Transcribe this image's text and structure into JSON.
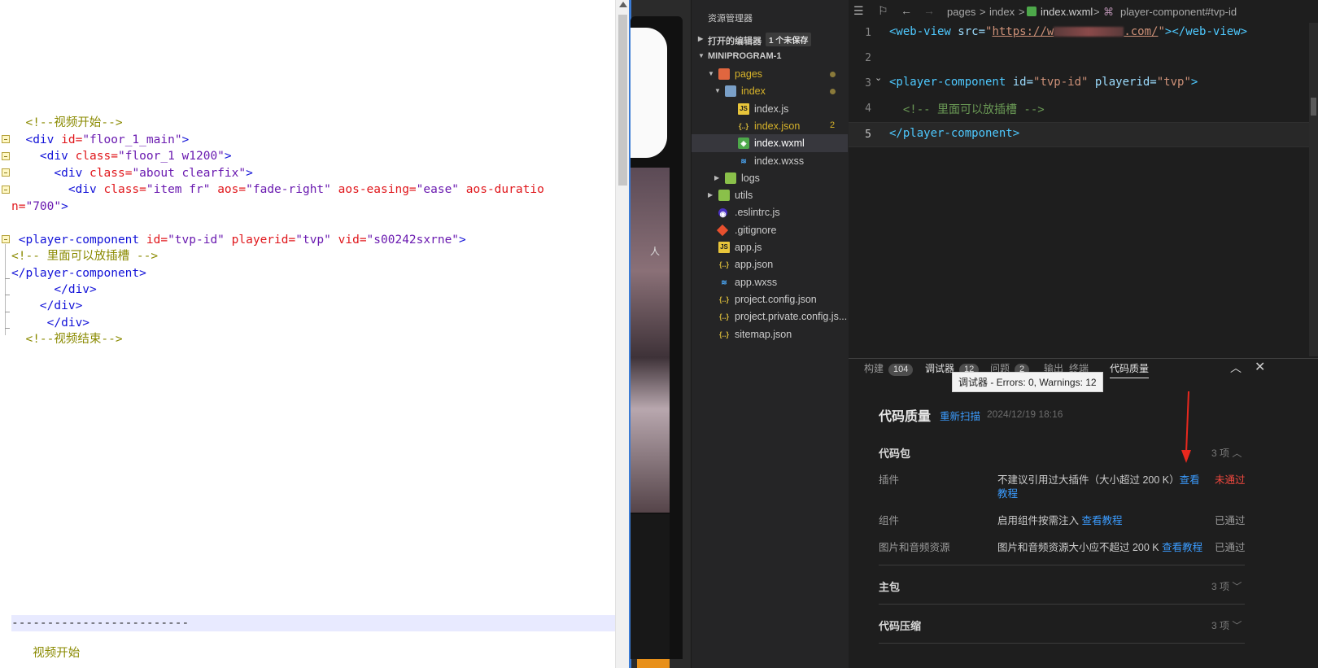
{
  "left_editor": {
    "lines": [
      {
        "indent": "  ",
        "parts": [
          [
            "c-com",
            "<!--视频开始-->"
          ]
        ]
      },
      {
        "indent": "  ",
        "parts": [
          [
            "c-tag",
            "<div "
          ],
          [
            "c-attr",
            "id="
          ],
          [
            "c-val",
            "\"floor_1_main\""
          ],
          [
            "c-tag",
            ">"
          ]
        ]
      },
      {
        "indent": "    ",
        "parts": [
          [
            "c-tag",
            "<div "
          ],
          [
            "c-attr",
            "class="
          ],
          [
            "c-val",
            "\"floor_1 w1200\""
          ],
          [
            "c-tag",
            ">"
          ]
        ]
      },
      {
        "indent": "      ",
        "parts": [
          [
            "c-tag",
            "<div "
          ],
          [
            "c-attr",
            "class="
          ],
          [
            "c-val",
            "\"about clearfix\""
          ],
          [
            "c-tag",
            ">"
          ]
        ]
      },
      {
        "indent": "        ",
        "parts": [
          [
            "c-tag",
            "<div "
          ],
          [
            "c-attr",
            "class="
          ],
          [
            "c-val",
            "\"item fr\" "
          ],
          [
            "c-attr",
            "aos="
          ],
          [
            "c-val",
            "\"fade-right\" "
          ],
          [
            "c-attr",
            "aos-easing="
          ],
          [
            "c-val",
            "\"ease\" "
          ],
          [
            "c-attr",
            "aos-duratio"
          ]
        ]
      },
      {
        "indent": "",
        "parts": [
          [
            "c-attr",
            "n="
          ],
          [
            "c-val",
            "\"700\""
          ],
          [
            "c-tag",
            ">"
          ]
        ]
      },
      {
        "indent": "",
        "parts": []
      },
      {
        "indent": " ",
        "parts": [
          [
            "c-tag",
            "<player-component "
          ],
          [
            "c-attr",
            "id="
          ],
          [
            "c-val",
            "\"tvp-id\" "
          ],
          [
            "c-attr",
            "playerid="
          ],
          [
            "c-val",
            "\"tvp\" "
          ],
          [
            "c-attr",
            "vid="
          ],
          [
            "c-val",
            "\"s00242sxrne\""
          ],
          [
            "c-tag",
            ">"
          ]
        ]
      },
      {
        "indent": "",
        "parts": [
          [
            "c-com",
            "<!-- 里面可以放插槽 -->"
          ]
        ]
      },
      {
        "indent": "",
        "parts": [
          [
            "c-tag",
            "</player-component>"
          ]
        ]
      },
      {
        "indent": "      ",
        "parts": [
          [
            "c-tag",
            "</div>"
          ]
        ]
      },
      {
        "indent": "    ",
        "parts": [
          [
            "c-tag",
            "</div>"
          ]
        ]
      },
      {
        "indent": "     ",
        "parts": [
          [
            "c-tag",
            "</div>"
          ]
        ]
      },
      {
        "indent": "  ",
        "parts": [
          [
            "c-com",
            "<!--视频结束-->"
          ]
        ]
      }
    ],
    "divider_text": "-------------------------",
    "bottom_partial": "   视频开始"
  },
  "simulator": {
    "label": "人"
  },
  "explorer": {
    "title": "资源管理器",
    "more": "···",
    "open_editors": {
      "label": "打开的编辑器",
      "badge": "1 个未保存"
    },
    "project": {
      "label": "MINIPROGRAM-1"
    },
    "tree": [
      {
        "name": "pages",
        "type": "folder-red",
        "level": 1,
        "open": true,
        "color": "#d7b32a",
        "dot": true
      },
      {
        "name": "index",
        "type": "folder-open",
        "level": 2,
        "open": true,
        "color": "#d7b32a",
        "dot": true
      },
      {
        "name": "index.js",
        "type": "js",
        "level": 3
      },
      {
        "name": "index.json",
        "type": "json",
        "level": 3,
        "color": "#d7b32a",
        "count": "2"
      },
      {
        "name": "index.wxml",
        "type": "wxml",
        "level": 3,
        "selected": true
      },
      {
        "name": "index.wxss",
        "type": "wxss",
        "level": 3
      },
      {
        "name": "logs",
        "type": "folder-green",
        "level": 2,
        "open": false
      },
      {
        "name": "utils",
        "type": "folder-green",
        "level": 1,
        "open": false
      },
      {
        "name": ".eslintrc.js",
        "type": "eslint",
        "level": 1
      },
      {
        "name": ".gitignore",
        "type": "git",
        "level": 1
      },
      {
        "name": "app.js",
        "type": "js",
        "level": 1
      },
      {
        "name": "app.json",
        "type": "json",
        "level": 1
      },
      {
        "name": "app.wxss",
        "type": "wxss",
        "level": 1
      },
      {
        "name": "project.config.json",
        "type": "json",
        "level": 1
      },
      {
        "name": "project.private.config.js...",
        "type": "json",
        "level": 1
      },
      {
        "name": "sitemap.json",
        "type": "json",
        "level": 1
      }
    ]
  },
  "breadcrumb": {
    "items": [
      "pages",
      "index",
      "index.wxml",
      "player-component#tvp-id"
    ],
    "separator": ">"
  },
  "editor": {
    "current_line": 5,
    "lines": [
      {
        "num": "1",
        "parts": [
          [
            "d-tag",
            "<web-view "
          ],
          [
            "d-attr",
            "src="
          ],
          [
            "d-val",
            "\""
          ],
          [
            "d-url",
            "https://w"
          ],
          [
            "blur",
            ""
          ],
          [
            "d-url",
            ".com/"
          ],
          [
            "d-val",
            "\""
          ],
          [
            "d-tag",
            "></web-view>"
          ]
        ]
      },
      {
        "num": "2",
        "parts": []
      },
      {
        "num": "3",
        "parts": [
          [
            "d-tag",
            "<player-component "
          ],
          [
            "d-attr",
            "id="
          ],
          [
            "d-val",
            "\"tvp-id\" "
          ],
          [
            "d-attr",
            "playerid="
          ],
          [
            "d-val",
            "\"tvp\""
          ],
          [
            "d-tag",
            ">"
          ]
        ]
      },
      {
        "num": "4",
        "parts": [
          [
            "d-com",
            "  <!-- 里面可以放插槽 -->"
          ]
        ]
      },
      {
        "num": "5",
        "parts": [
          [
            "d-tag",
            "</player-component>"
          ]
        ]
      }
    ]
  },
  "panel": {
    "tabs": [
      {
        "label": "构建",
        "badge": "104"
      },
      {
        "label": "调试器",
        "badge": "12",
        "bold": true
      },
      {
        "label": "问题",
        "badge": "2"
      },
      {
        "label": "输出"
      },
      {
        "label": "终端"
      },
      {
        "label": "代码质量",
        "active": true
      }
    ],
    "tooltip": "调试器 - Errors: 0, Warnings: 12",
    "collapse_icon": "︿",
    "close_icon": "✕"
  },
  "code_quality": {
    "title": "代码质量",
    "rescan": "重新扫描",
    "timestamp": "2024/12/19 18:16",
    "groups": [
      {
        "name": "代码包",
        "count": "3 项",
        "expanded": true,
        "items": [
          {
            "name": "插件",
            "desc": "不建议引用过大插件（大小超过 200 K）",
            "link": "查看",
            "link2": "教程",
            "status": "未通过",
            "pass": false
          },
          {
            "name": "组件",
            "desc": "启用组件按需注入 ",
            "link": "查看教程",
            "status": "已通过",
            "pass": true
          },
          {
            "name": "图片和音频资源",
            "desc": "图片和音频资源大小应不超过 200 K ",
            "link": "查看教程",
            "status": "已通过",
            "pass": true
          }
        ]
      },
      {
        "name": "主包",
        "count": "3 项",
        "expanded": false
      },
      {
        "name": "代码压缩",
        "count": "3 项",
        "expanded": false
      }
    ]
  },
  "colors": {
    "accent_link": "#3b9cff",
    "fail": "#f0483e",
    "annotation_arrow": "#e8281e"
  }
}
